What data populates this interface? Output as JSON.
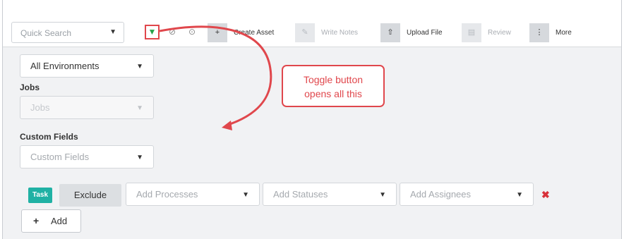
{
  "toolbar": {
    "quick_search": "Quick Search",
    "buttons": [
      {
        "label": "Create Asset",
        "icon": "plus-icon",
        "enabled": true
      },
      {
        "label": "Write Notes",
        "icon": "edit-icon",
        "enabled": false
      },
      {
        "label": "Upload File",
        "icon": "upload-icon",
        "enabled": true
      },
      {
        "label": "Review",
        "icon": "review-icon",
        "enabled": false
      },
      {
        "label": "More",
        "icon": "more-icon",
        "enabled": true
      }
    ]
  },
  "filters": {
    "environment": "All Environments",
    "jobs_label": "Jobs",
    "jobs_placeholder": "Jobs",
    "custom_fields_label": "Custom Fields",
    "custom_fields_placeholder": "Custom Fields",
    "rule": {
      "badge": "Task",
      "exclude_label": "Exclude",
      "processes_placeholder": "Add Processes",
      "statuses_placeholder": "Add Statuses",
      "assignees_placeholder": "Add Assignees"
    },
    "add_label": "Add"
  },
  "annotation": {
    "line1": "Toggle button",
    "line2": "opens all this",
    "color": "#e0474c"
  },
  "colors": {
    "accent_teal": "#20b1a4",
    "filter_green": "#27a34a",
    "remove_red": "#d8313a"
  }
}
